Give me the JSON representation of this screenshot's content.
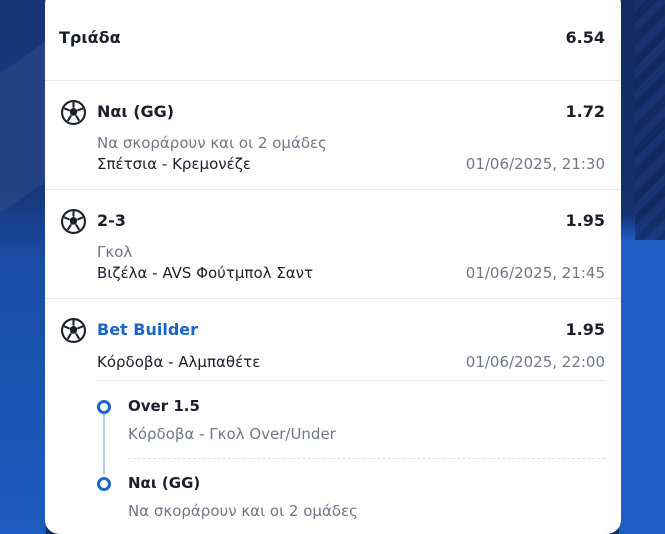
{
  "colors": {
    "accent": "#1a66c9",
    "card": "#ffffff",
    "background": "#0d2a66",
    "muted": "#6f7787"
  },
  "summary": {
    "label": "Τριάδα",
    "odd": "6.54"
  },
  "selections": [
    {
      "icon": "soccer-ball-icon",
      "name": "Ναι (GG)",
      "odd": "1.72",
      "market": "Να σκοράρουν και οι 2 ομάδες",
      "match": "Σπέτσια - Κρεμονέζε",
      "date": "01/06/2025, 21:30"
    },
    {
      "icon": "soccer-ball-icon",
      "name": "2-3",
      "odd": "1.95",
      "market": "Γκολ",
      "match": "Βιζέλα - AVS Φούτμπολ Σαντ",
      "date": "01/06/2025, 21:45"
    },
    {
      "icon": "soccer-ball-icon",
      "name": "Bet Builder",
      "odd": "1.95",
      "match": "Κόρδοβα - Αλμπαθέτε",
      "date": "01/06/2025, 22:00",
      "legs": [
        {
          "name": "Over 1.5",
          "market": "Κόρδοβα - Γκολ Over/Under"
        },
        {
          "name": "Ναι (GG)",
          "market": "Να σκοράρουν και οι 2 ομάδες"
        }
      ]
    }
  ]
}
